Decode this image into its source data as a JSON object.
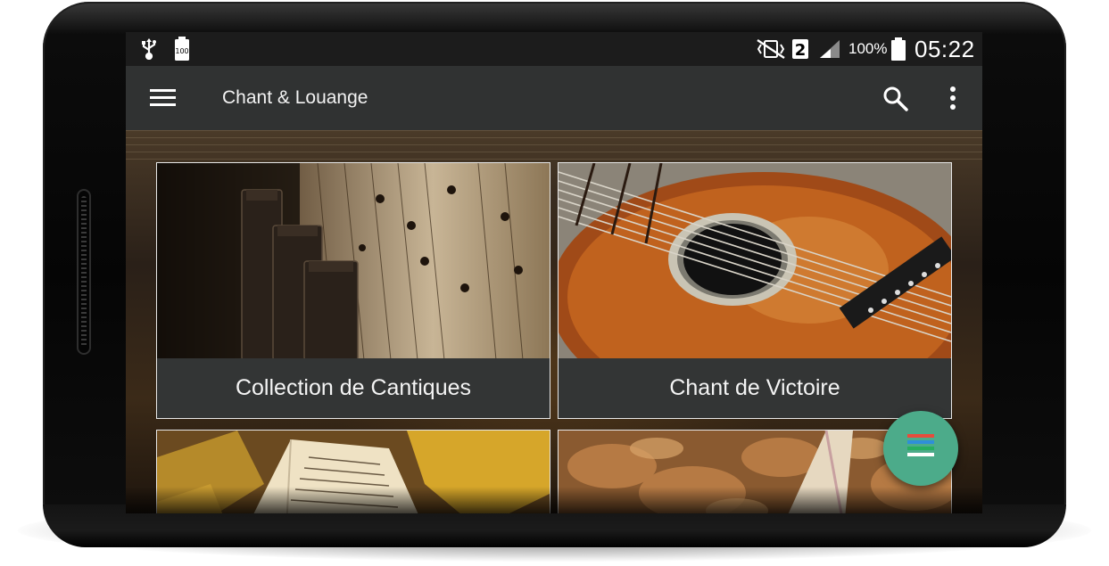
{
  "status_bar": {
    "left_icons": [
      "usb-icon",
      "battery-saver-icon"
    ],
    "battery_saver_label": "100",
    "right_icons": [
      "vibrate-off-icon",
      "sim-2-icon",
      "signal-icon",
      "battery-icon"
    ],
    "sim_label": "2",
    "battery_percent": "100%",
    "time": "05:22"
  },
  "app_bar": {
    "title": "Chant & Louange",
    "menu_icon": "hamburger-menu-icon",
    "search_icon": "search-icon",
    "overflow_icon": "more-vert-icon"
  },
  "cards": [
    {
      "label": "Collection de Cantiques",
      "image": "piano-sheet-music"
    },
    {
      "label": "Chant de Victoire",
      "image": "acoustic-guitar"
    },
    {
      "label": "",
      "image": "book-autumn-leaves"
    },
    {
      "label": "",
      "image": "open-book-leaves"
    }
  ],
  "fab": {
    "icon": "colored-list-icon",
    "colors": [
      "#e74c3c",
      "#2f8fd8",
      "#27ae60",
      "#ffffff"
    ]
  },
  "theme": {
    "status_bar_bg": "#1c1c1c",
    "app_bar_bg": "#303232",
    "card_label_bg": "#333535",
    "fab_bg": "#4cab8a"
  }
}
